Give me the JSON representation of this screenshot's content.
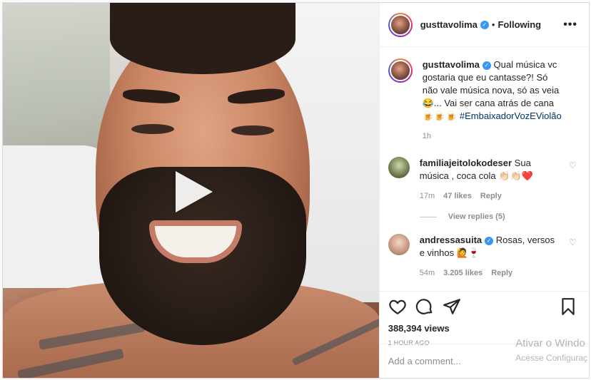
{
  "header": {
    "username": "gusttavolima",
    "dot": "•",
    "follow_status": "Following",
    "more": "•••"
  },
  "caption": {
    "username": "gusttavolima",
    "text": "Qual música vc gostaria que eu cantasse?! Só não vale música nova, só as veia 😂... Vai ser cana atrás de cana 🍺🍺🍺",
    "hashtag": "#EmbaixadorVozEViolão",
    "time": "1h"
  },
  "comments": [
    {
      "username": "familiajeitolokodeser",
      "text": "Sua música , coca cola 👏🏻👏🏻❤️",
      "time": "17m",
      "likes": "47 likes",
      "reply": "Reply",
      "view_replies": "View replies (5)"
    },
    {
      "username": "andressasuita",
      "text": "Rosas, versos e vinhos 🙋🍷",
      "time": "54m",
      "likes": "3.205 likes",
      "reply": "Reply"
    }
  ],
  "actions": {
    "views": "388,394 views",
    "posted": "1 HOUR AGO"
  },
  "add_comment": {
    "placeholder": "Add a comment..."
  },
  "watermark": {
    "line1": "Ativar o Windo",
    "line2": "Acesse Configuraç"
  },
  "colors": {
    "link": "#003569",
    "verified": "#3897f0",
    "secondary_text": "#8e8e8e"
  },
  "icons": [
    "play-icon",
    "heart-icon",
    "comment-icon",
    "share-icon",
    "bookmark-icon",
    "more-icon",
    "verified-icon"
  ]
}
